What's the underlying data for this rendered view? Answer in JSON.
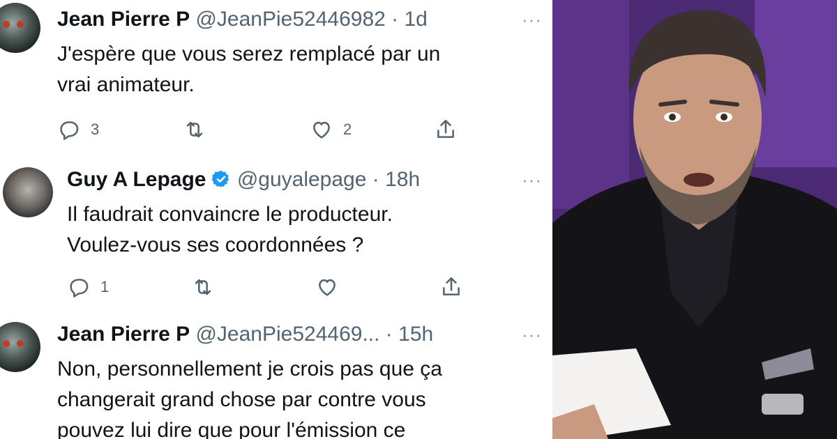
{
  "tweets": [
    {
      "name": "Jean Pierre P",
      "handle": "@JeanPie52446982",
      "separator": "·",
      "time": "1d",
      "lines": [
        "J'espère que vous serez remplacé par un",
        "vrai animateur."
      ],
      "reply_count": "3",
      "retweet_count": "",
      "like_count": "2",
      "verified": false,
      "avatar": "robot-avatar"
    },
    {
      "name": "Guy A Lepage",
      "handle": "@guyalepage",
      "separator": "·",
      "time": "18h",
      "lines": [
        "Il faudrait convaincre le producteur.",
        "Voulez-vous ses coordonnées ?"
      ],
      "reply_count": "1",
      "retweet_count": "",
      "like_count": "",
      "verified": true,
      "avatar": "man-avatar"
    },
    {
      "name": "Jean Pierre P",
      "handle": "@JeanPie524469...",
      "separator": "·",
      "time": "15h",
      "lines": [
        "Non, personnellement je crois pas que ça",
        "changerait grand chose par contre vous",
        "pouvez lui dire que pour l'émission ce"
      ],
      "verified": false,
      "avatar": "robot-avatar"
    }
  ],
  "more_label": "···",
  "icons": {
    "reply": "reply-icon",
    "retweet": "retweet-icon",
    "like": "heart-icon",
    "share": "share-icon",
    "verified": "verified-badge-icon"
  },
  "colors": {
    "text": "#0f1419",
    "secondary": "#536471",
    "verified": "#1d9bf0",
    "photo_background": "#5a2f88"
  }
}
